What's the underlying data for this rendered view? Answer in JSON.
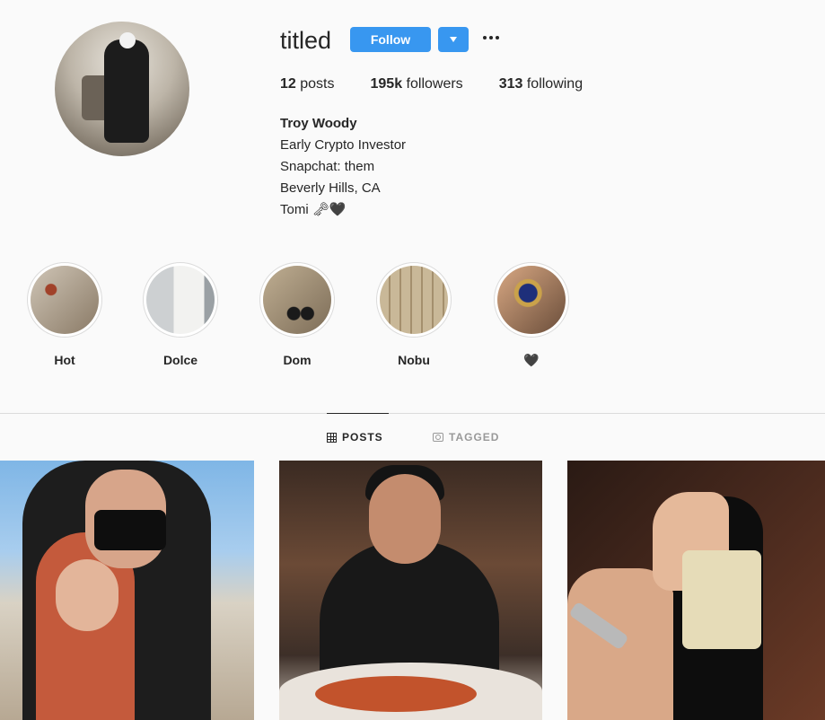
{
  "profile": {
    "username": "titled",
    "follow_label": "Follow",
    "stats": {
      "posts_count": "12",
      "posts_label": "posts",
      "followers_count": "195k",
      "followers_label": "followers",
      "following_count": "313",
      "following_label": "following"
    },
    "bio": {
      "name": "Troy Woody",
      "lines": [
        "Early Crypto Investor",
        "Snapchat: them",
        "Beverly Hills, CA",
        "Tomi 🗝🖤"
      ]
    }
  },
  "highlights": [
    {
      "label": "Hot",
      "color": "#8a6a4f"
    },
    {
      "label": "Dolce",
      "color": "#d8d2c8"
    },
    {
      "label": "Dom",
      "color": "#9a8a74"
    },
    {
      "label": "Nobu",
      "color": "#b6a587"
    },
    {
      "label": "🖤",
      "color": "#6a5a4a"
    }
  ],
  "tabs": {
    "posts": "POSTS",
    "tagged": "TAGGED"
  },
  "colors": {
    "accent": "#3897f0",
    "background": "#fafafa",
    "text": "#262626",
    "muted": "#999999"
  }
}
